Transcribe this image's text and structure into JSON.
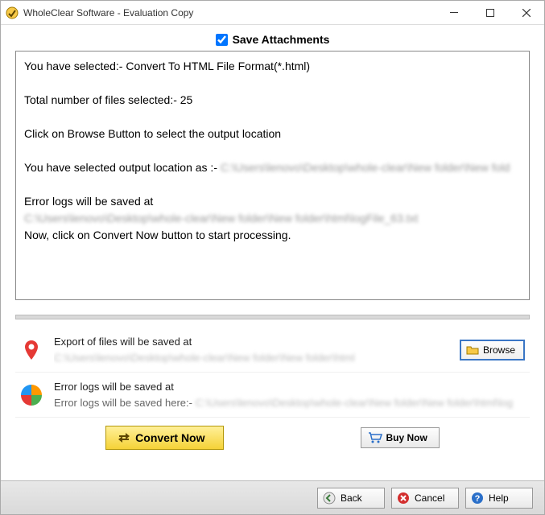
{
  "window": {
    "title": "WholeClear Software - Evaluation Copy"
  },
  "checkbox": {
    "save_attachments_label": "Save Attachments",
    "checked": true
  },
  "log": {
    "line1_prefix": "You have selected:- Convert To HTML File Format(*.html)",
    "line2": "Total number of files selected:- 25",
    "line3": "Click on Browse Button to select the output location",
    "line4_prefix": "You have selected output location as :- ",
    "line4_path": "C:\\Users\\lenovo\\Desktop\\whole-clear\\New folder\\New fold",
    "line5": "Error logs will be saved at",
    "line6_path": "C:\\Users\\lenovo\\Desktop\\whole-clear\\New folder\\New folder\\html\\logFile_63.txt",
    "line7": "Now, click on Convert Now button to start processing."
  },
  "export": {
    "heading": "Export of files will be saved at",
    "path": "C:\\Users\\lenovo\\Desktop\\whole-clear\\New folder\\New folder\\html",
    "browse_label": "Browse"
  },
  "errlog": {
    "heading": "Error logs will be saved at",
    "prefix": "Error logs will be saved here:- ",
    "path": "C:\\Users\\lenovo\\Desktop\\whole-clear\\New folder\\New folder\\html\\log"
  },
  "actions": {
    "convert_label": "Convert Now",
    "buy_label": "Buy Now"
  },
  "nav": {
    "back": "Back",
    "cancel": "Cancel",
    "help": "Help"
  }
}
